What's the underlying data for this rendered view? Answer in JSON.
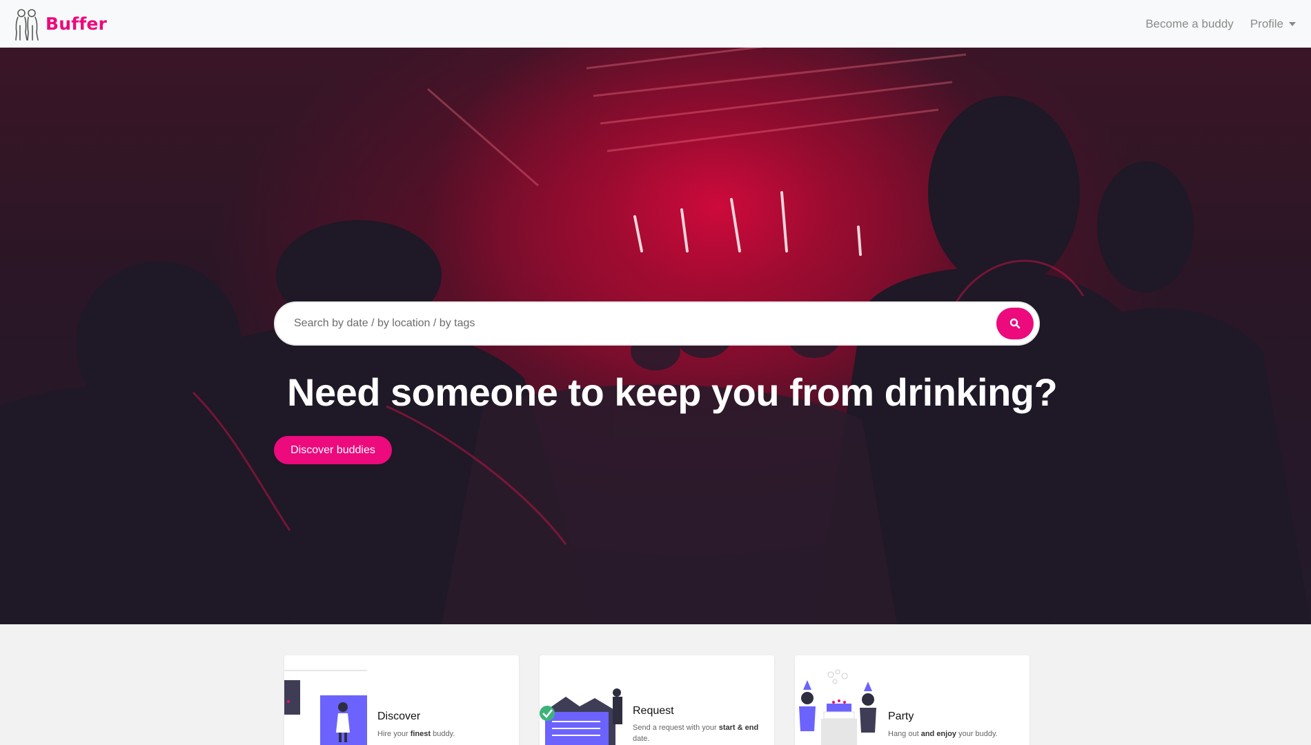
{
  "navbar": {
    "brand_name": "Buffer",
    "links": [
      {
        "label": "Become a buddy"
      },
      {
        "label": "Profile"
      }
    ]
  },
  "hero": {
    "search_placeholder": "Search by date / by location / by tags",
    "headline": "Need someone to keep you from drinking?",
    "cta_label": "Discover buddies"
  },
  "features": [
    {
      "title": "Discover",
      "desc_parts": [
        "Hire your ",
        "finest",
        " buddy."
      ]
    },
    {
      "title": "Request",
      "desc_parts": [
        "Send a request with your ",
        "start &",
        " ",
        "end",
        " date."
      ]
    },
    {
      "title": "Party",
      "desc_parts": [
        "Hang out ",
        "and enjoy",
        " your buddy."
      ]
    }
  ],
  "colors": {
    "accent": "#ec0a7d",
    "navbar_bg": "#f8f9fa",
    "illustration_purple": "#6c63ff"
  }
}
